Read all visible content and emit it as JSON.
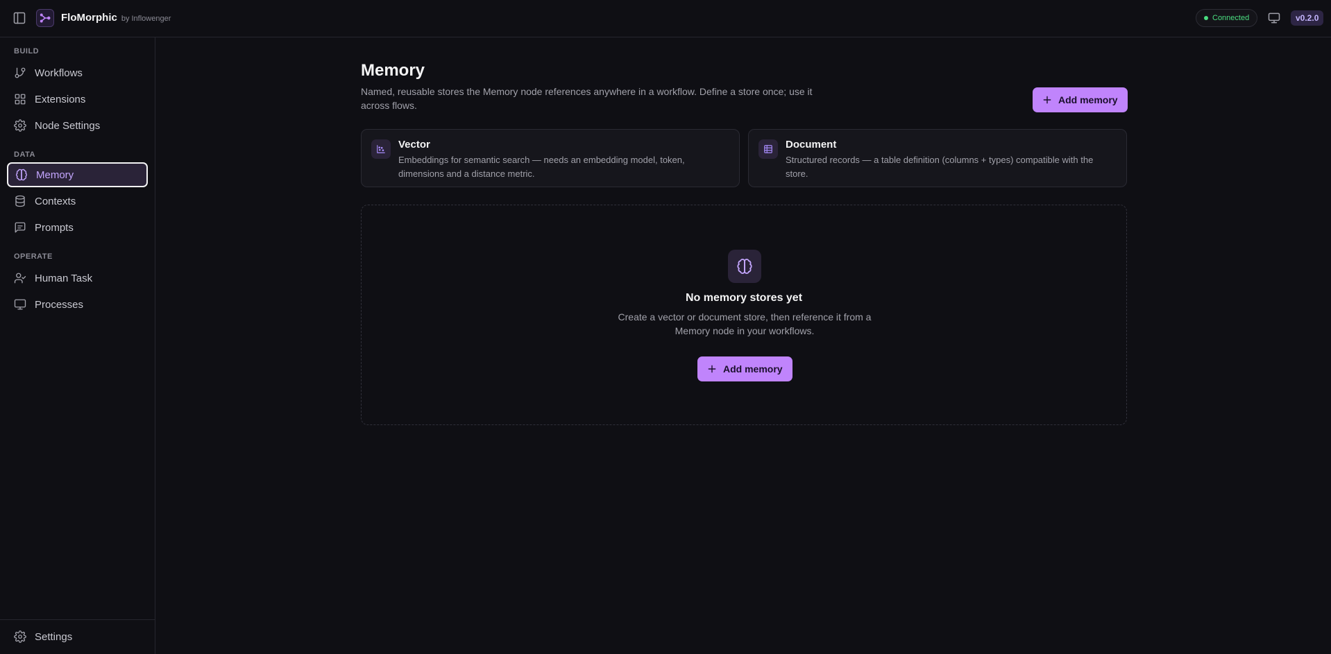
{
  "header": {
    "brand_name": "FloMorphic",
    "brand_by": "by Inflowenger",
    "status": "Connected",
    "version": "v0.2.0"
  },
  "sidebar": {
    "sections": [
      {
        "label": "BUILD"
      },
      {
        "label": "DATA"
      },
      {
        "label": "OPERATE"
      }
    ],
    "items": [
      {
        "label": "Workflows",
        "icon": "git-branch-icon"
      },
      {
        "label": "Extensions",
        "icon": "grid-icon"
      },
      {
        "label": "Node Settings",
        "icon": "gear-icon"
      },
      {
        "label": "Memory",
        "icon": "brain-icon",
        "active": true
      },
      {
        "label": "Contexts",
        "icon": "database-icon"
      },
      {
        "label": "Prompts",
        "icon": "message-square-icon"
      },
      {
        "label": "Human Task",
        "icon": "user-check-icon"
      },
      {
        "label": "Processes",
        "icon": "monitor-icon"
      }
    ],
    "footer": {
      "label": "Settings",
      "icon": "gear-icon"
    }
  },
  "main": {
    "title": "Memory",
    "description": "Named, reusable stores the Memory node references anywhere in a workflow. Define a store once; use it across flows.",
    "add_button_label": "Add memory",
    "types": [
      {
        "title": "Vector",
        "description": "Embeddings for semantic search — needs an embedding model, token, dimensions and a distance metric.",
        "icon": "scatter-chart-icon"
      },
      {
        "title": "Document",
        "description": "Structured records — a table definition (columns + types) compatible with the store.",
        "icon": "table-icon"
      }
    ],
    "empty": {
      "title": "No memory stores yet",
      "description": "Create a vector or document store, then reference it from a Memory node in your workflows.",
      "button_label": "Add memory"
    }
  },
  "colors": {
    "background": "#0f0f14",
    "accent": "#c084fc",
    "status": "#4ade80"
  }
}
